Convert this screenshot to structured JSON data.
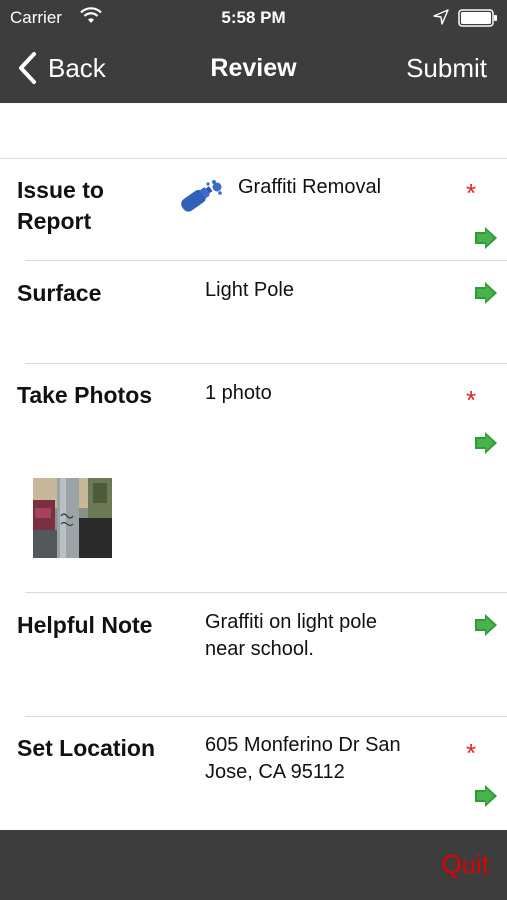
{
  "status_bar": {
    "carrier": "Carrier",
    "time": "5:58 PM"
  },
  "nav": {
    "back_label": "Back",
    "title": "Review",
    "submit_label": "Submit"
  },
  "rows": {
    "issue": {
      "label_line1": "Issue to",
      "label_line2": "Report",
      "value": "Graffiti Removal",
      "required": "*"
    },
    "surface": {
      "label": "Surface",
      "value": "Light Pole"
    },
    "photos": {
      "label": "Take Photos",
      "value": "1 photo",
      "required": "*"
    },
    "note": {
      "label": "Helpful Note",
      "value_line1": "Graffiti on light pole",
      "value_line2": "near school."
    },
    "location": {
      "label": "Set Location",
      "value_line1": "605 Monferino Dr San",
      "value_line2": "Jose, CA 95112",
      "required": "*"
    }
  },
  "bottom": {
    "quit_label": "Quit"
  },
  "colors": {
    "bar_background": "#3d3d3d",
    "required_star": "#e02020",
    "quit": "#e00000",
    "arrow_green": "#2e9a3a"
  },
  "icons": {
    "issue_icon": "spray-can-icon",
    "row_action": "green-arrow-icon"
  }
}
